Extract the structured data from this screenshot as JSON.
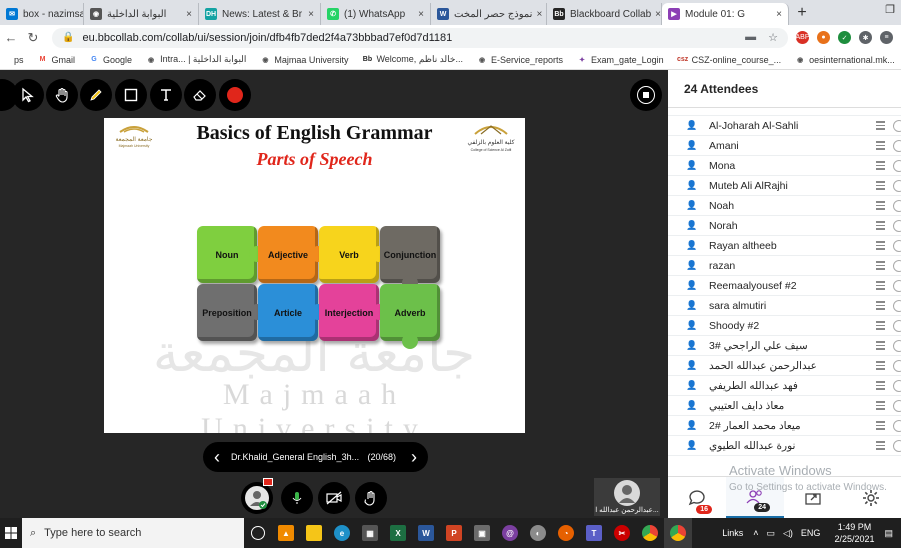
{
  "browser": {
    "tabs": [
      {
        "label": "box - nazimsatt",
        "icon": "mail-icon",
        "color": "#0078d4",
        "glyph": "✉"
      },
      {
        "label": "البوابة الداخلية",
        "icon": "globe-icon",
        "color": "#555555",
        "glyph": "◉"
      },
      {
        "label": "News: Latest & Br",
        "icon": "dh-icon",
        "color": "#14a3a3",
        "glyph": "DH"
      },
      {
        "label": "(1) WhatsApp",
        "icon": "whatsapp-icon",
        "color": "#25d366",
        "glyph": "✆"
      },
      {
        "label": "نموذج حصر المخت",
        "icon": "word-icon",
        "color": "#2b579a",
        "glyph": "W"
      },
      {
        "label": "Blackboard Collab",
        "icon": "blackboard-icon",
        "color": "#262626",
        "glyph": "Bb"
      },
      {
        "label": "Module 01: G",
        "icon": "module-icon",
        "color": "#8c3fb5",
        "glyph": "▶",
        "active": true
      }
    ],
    "url": "eu.bbcollab.com/collab/ui/session/join/dfb4fb7ded2f4a73bbbad7ef0d7d1181",
    "bookmarks": [
      {
        "label": "ps",
        "icon": "apps-icon",
        "color": "#4285f4",
        "glyph": ""
      },
      {
        "label": "Gmail",
        "icon": "gmail-icon",
        "color": "#ea4335",
        "glyph": "M"
      },
      {
        "label": "Google",
        "icon": "google-icon",
        "color": "#4285f4",
        "glyph": "G"
      },
      {
        "label": "Intra... | البوابة الداخلية",
        "icon": "globe-icon",
        "color": "#555555",
        "glyph": "◉"
      },
      {
        "label": "Majmaa University",
        "icon": "globe-icon",
        "color": "#555555",
        "glyph": "◉"
      },
      {
        "label": "Welcome, خالد ناظم...",
        "icon": "bb-icon",
        "color": "#262626",
        "glyph": "Bb"
      },
      {
        "label": "E-Service_reports",
        "icon": "globe-icon",
        "color": "#555555",
        "glyph": "◉"
      },
      {
        "label": "Exam_gate_Login",
        "icon": "exam-icon",
        "color": "#7b3fa0",
        "glyph": "✦"
      },
      {
        "label": "CSZ-online_course_...",
        "icon": "csz-icon",
        "color": "#c0392b",
        "glyph": "csz"
      },
      {
        "label": "oesinternational.mk...",
        "icon": "globe-icon",
        "color": "#555555",
        "glyph": "◉"
      }
    ]
  },
  "slide": {
    "title": "Basics of English Grammar",
    "subtitle": "Parts of Speech",
    "logo_right_text": "كلية العلوم بالزلفي",
    "logo_right_sub": "College of Science Al Zulfi",
    "logo_left_text": "جامعة المجمعة",
    "logo_left_sub": "Majmaah University",
    "watermark_ar": "جامعة المجمعة",
    "watermark_en": "Majmaah University",
    "pieces": [
      {
        "label": "Noun",
        "color": "#7fcf3f"
      },
      {
        "label": "Adjective",
        "color": "#f28a1e"
      },
      {
        "label": "Verb",
        "color": "#f7d41c"
      },
      {
        "label": "Conjunction",
        "color": "#6e6a63"
      },
      {
        "label": "Preposition",
        "color": "#6f6f6f"
      },
      {
        "label": "Article",
        "color": "#2b8fd8"
      },
      {
        "label": "Interjection",
        "color": "#e4429a"
      },
      {
        "label": "Adverb",
        "color": "#6cc04a"
      }
    ]
  },
  "slidenav": {
    "file_name": "Dr.Khalid_General English_3h...",
    "counter": "(20/68)"
  },
  "self_view": {
    "name": "عبدالرحمن عبدالله ا..."
  },
  "attendees": {
    "header": "24 Attendees",
    "list": [
      "Al-Joharah Al-Sahli",
      "Amani",
      "Mona",
      "Muteb Ali AlRajhi",
      "Noah",
      "Norah",
      "Rayan altheeb",
      "razan",
      "Reemaalyousef #2",
      "sara almutiri",
      "Shoody #2",
      "سيف علي الراجحي #3",
      "عبدالرحمن عبدالله الحمد",
      "فهد عبدالله الطريفي",
      "معاذ دايف العتيبي",
      "ميعاد محمد العمار #2",
      "نورة عبدالله الطيوي"
    ],
    "chat_badge": "16",
    "attendees_badge": "24"
  },
  "watermark": {
    "line1": "Activate Windows",
    "line2": "Go to Settings to activate Windows."
  },
  "taskbar": {
    "search_placeholder": "Type here to search",
    "links_label": "Links",
    "time": "1:49 PM",
    "date": "2/25/2021"
  },
  "colors": {
    "accent_red": "#e0261b",
    "collab_bg": "#262626"
  }
}
